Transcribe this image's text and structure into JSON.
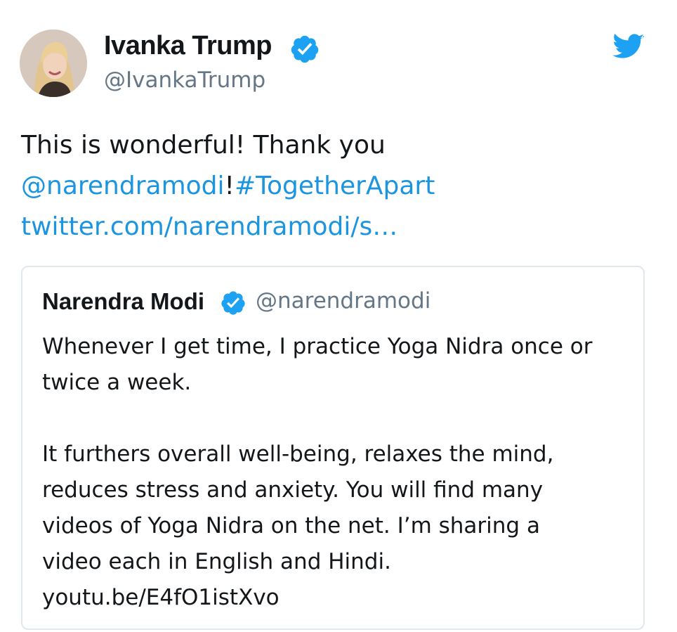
{
  "tweet": {
    "author_name": "Ivanka Trump",
    "author_handle": "@IvankaTrump",
    "text_line1": "This is wonderful! Thank you",
    "mention": "@narendramodi",
    "mention_suffix": "!",
    "hashtag": "#TogetherApart",
    "link": "twitter.com/narendramodi/s…"
  },
  "quoted_tweet": {
    "author_name": "Narendra Modi",
    "author_handle": "@narendramodi",
    "lines_p1": [
      "Whenever I get time, I practice Yoga Nidra once or",
      "twice a week."
    ],
    "lines_p2": [
      "It furthers overall well-being, relaxes the mind,",
      "reduces stress and anxiety. You will find many",
      "videos of Yoga Nidra on the net. I’m sharing a",
      "video each in English and Hindi."
    ],
    "link": "youtu.be/E4fO1istXvo"
  },
  "icons": {
    "verified": "verified-badge-icon",
    "logo": "twitter-bird-icon"
  },
  "colors": {
    "link": "#1b95e0",
    "verified": "#1da1f2",
    "secondary_text": "#657786",
    "border": "#e1e8ed"
  }
}
